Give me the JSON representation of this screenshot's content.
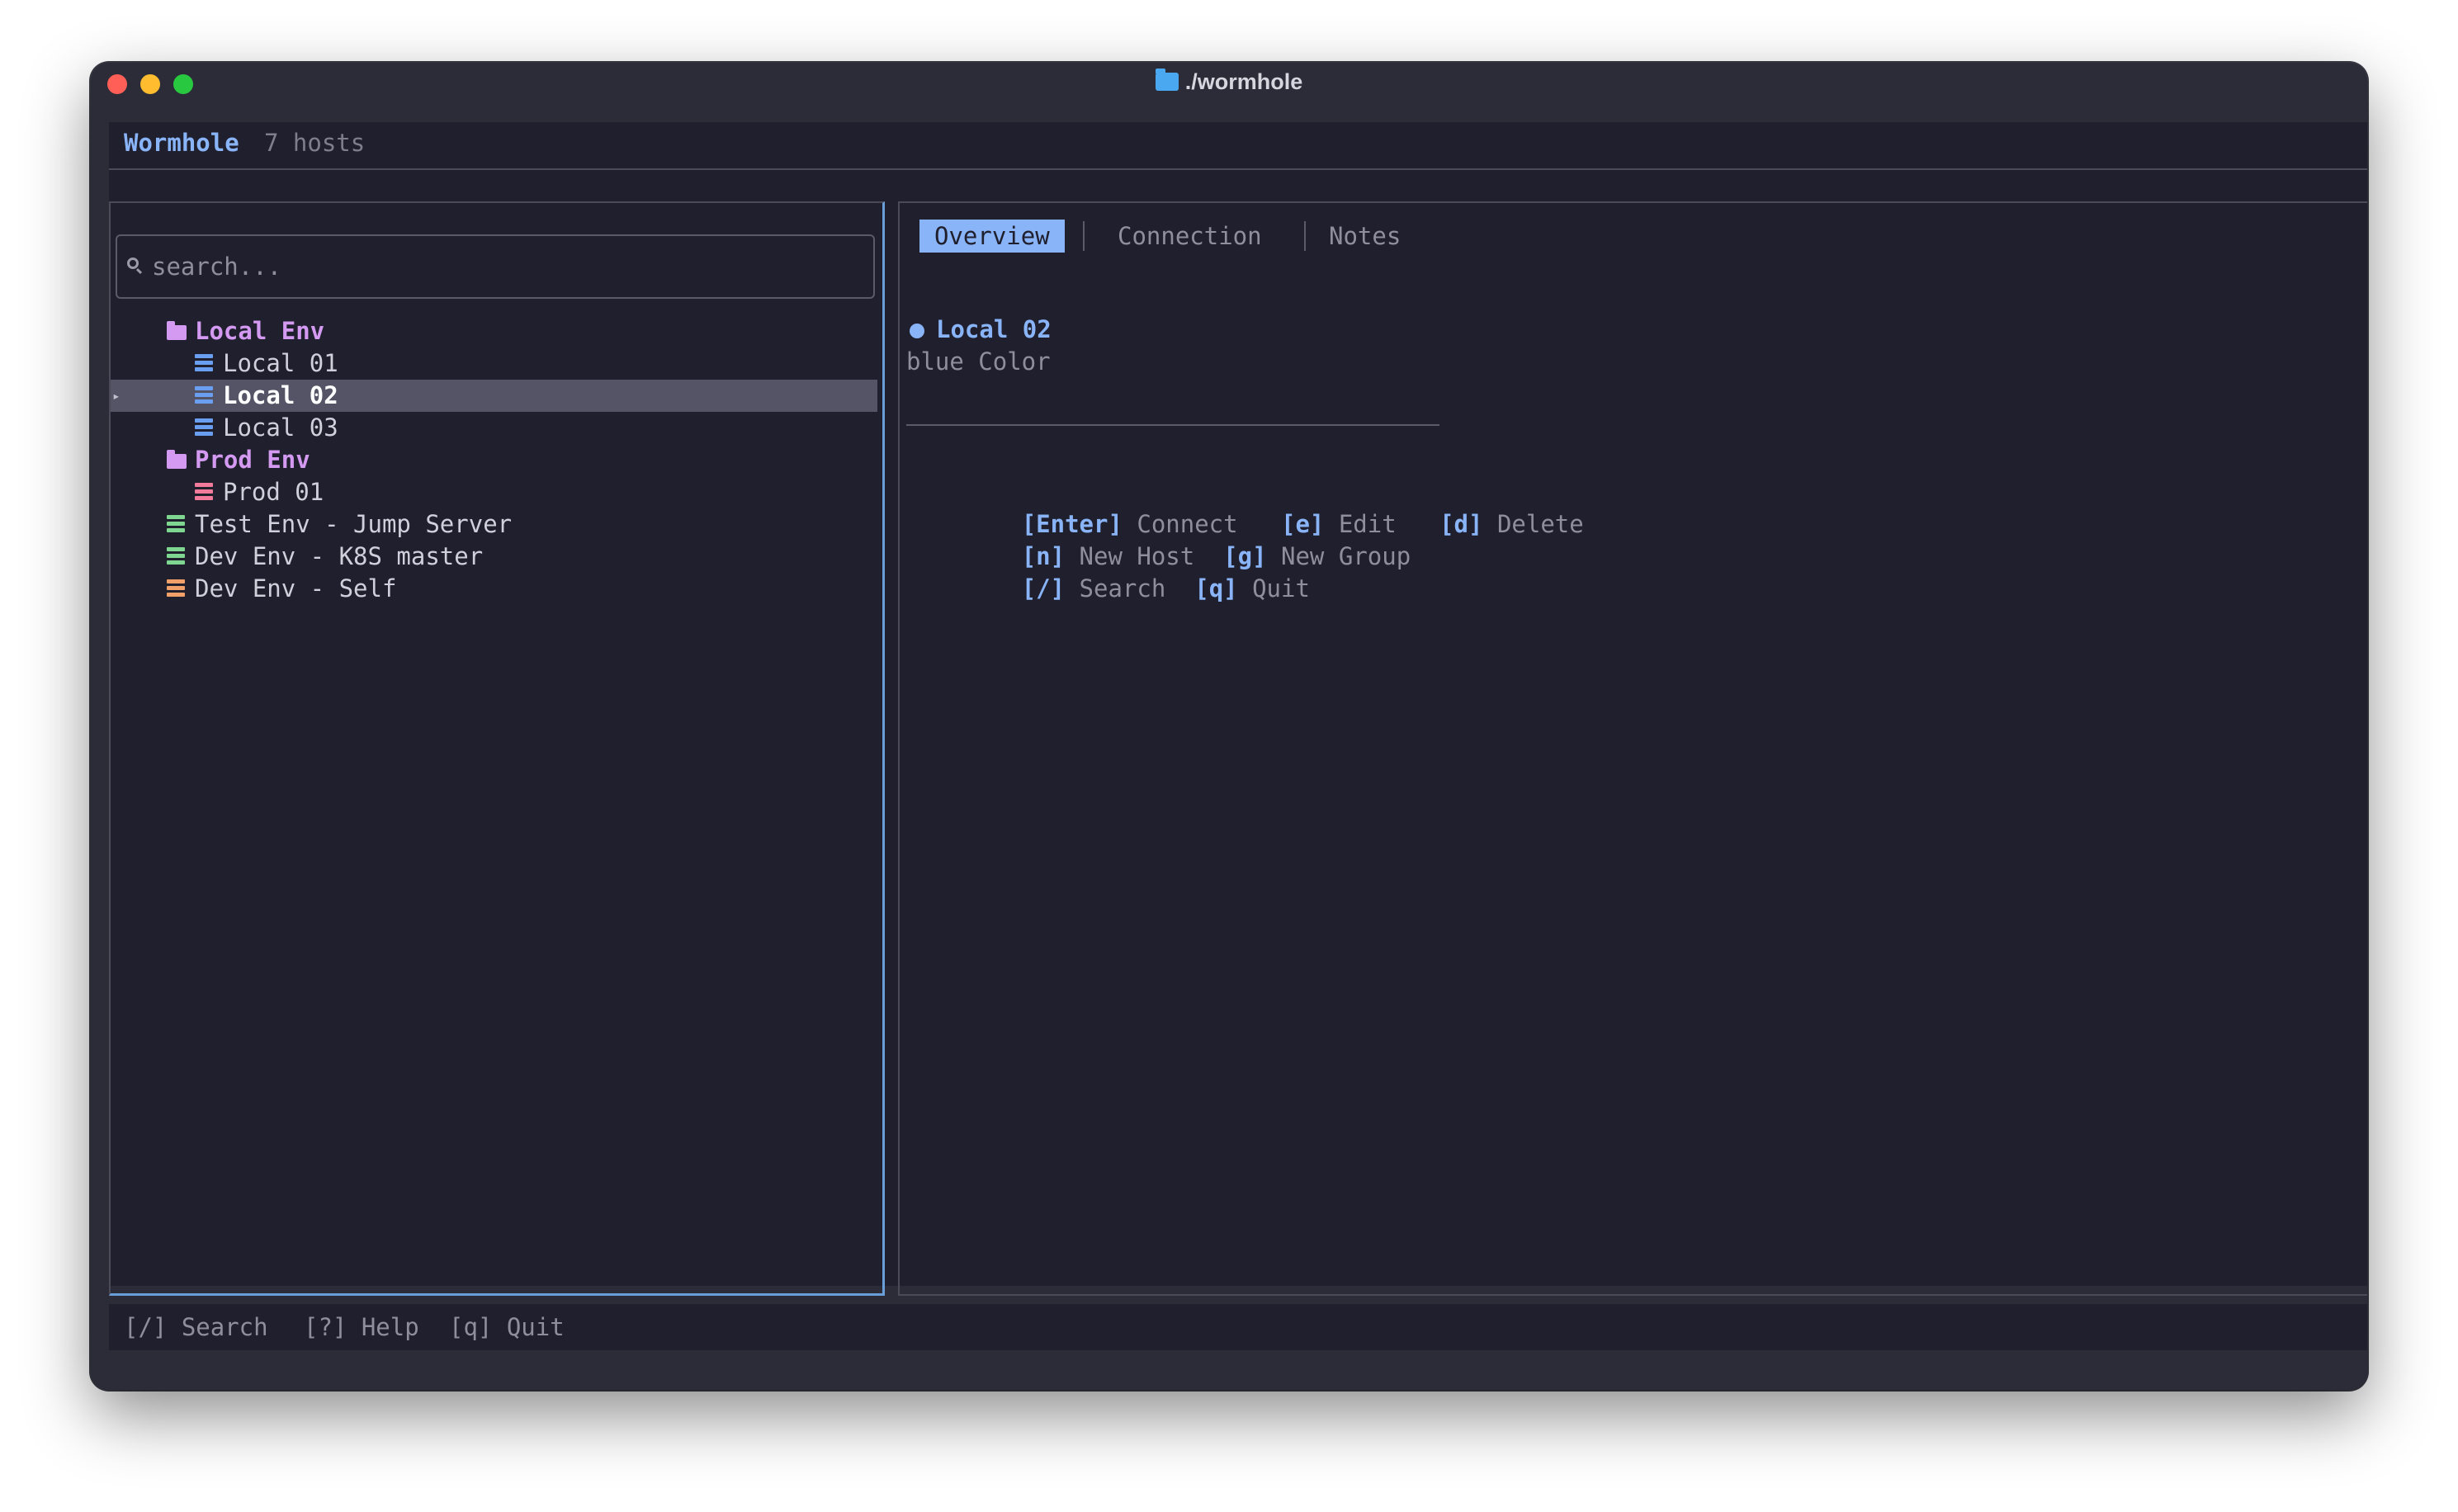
{
  "window": {
    "title": "./wormhole"
  },
  "header": {
    "app_name": "Wormhole",
    "host_count": "7 hosts"
  },
  "search": {
    "placeholder": "search...",
    "value": ""
  },
  "tree": [
    {
      "label": "Local Env",
      "type": "group",
      "level": 0,
      "color": "#d49af2"
    },
    {
      "label": "Local 01",
      "type": "host",
      "level": 1,
      "color": "#6a9ef0"
    },
    {
      "label": "Local 02",
      "type": "host",
      "level": 1,
      "color": "#6a9ef0",
      "selected": true
    },
    {
      "label": "Local 03",
      "type": "host",
      "level": 1,
      "color": "#6a9ef0"
    },
    {
      "label": "Prod Env",
      "type": "group",
      "level": 0,
      "color": "#d49af2"
    },
    {
      "label": "Prod 01",
      "type": "host",
      "level": 1,
      "color": "#f27a9a"
    },
    {
      "label": "Test Env - Jump Server",
      "type": "host",
      "level": 0,
      "color": "#7ed690"
    },
    {
      "label": "Dev Env - K8S master",
      "type": "host",
      "level": 0,
      "color": "#7ed690"
    },
    {
      "label": "Dev Env - Self",
      "type": "host",
      "level": 0,
      "color": "#f2a06a"
    }
  ],
  "tabs": [
    {
      "label": "Overview",
      "active": true
    },
    {
      "label": "Connection",
      "active": false
    },
    {
      "label": "Notes",
      "active": false
    }
  ],
  "detail": {
    "host_name": "Local 02",
    "color_text": "blue Color",
    "dot_color": "#8ab4f8"
  },
  "shortcuts": [
    [
      {
        "key": "[Enter]",
        "action": "Connect"
      },
      {
        "key": "[e]",
        "action": "Edit"
      },
      {
        "key": "[d]",
        "action": "Delete"
      }
    ],
    [
      {
        "key": "[n]",
        "action": "New Host"
      },
      {
        "key": "[g]",
        "action": "New Group"
      }
    ],
    [
      {
        "key": "[/]",
        "action": "Search"
      },
      {
        "key": "[q]",
        "action": "Quit"
      }
    ]
  ],
  "footer": {
    "search": "[/] Search",
    "help": "[?] Help",
    "quit": "[q] Quit"
  }
}
